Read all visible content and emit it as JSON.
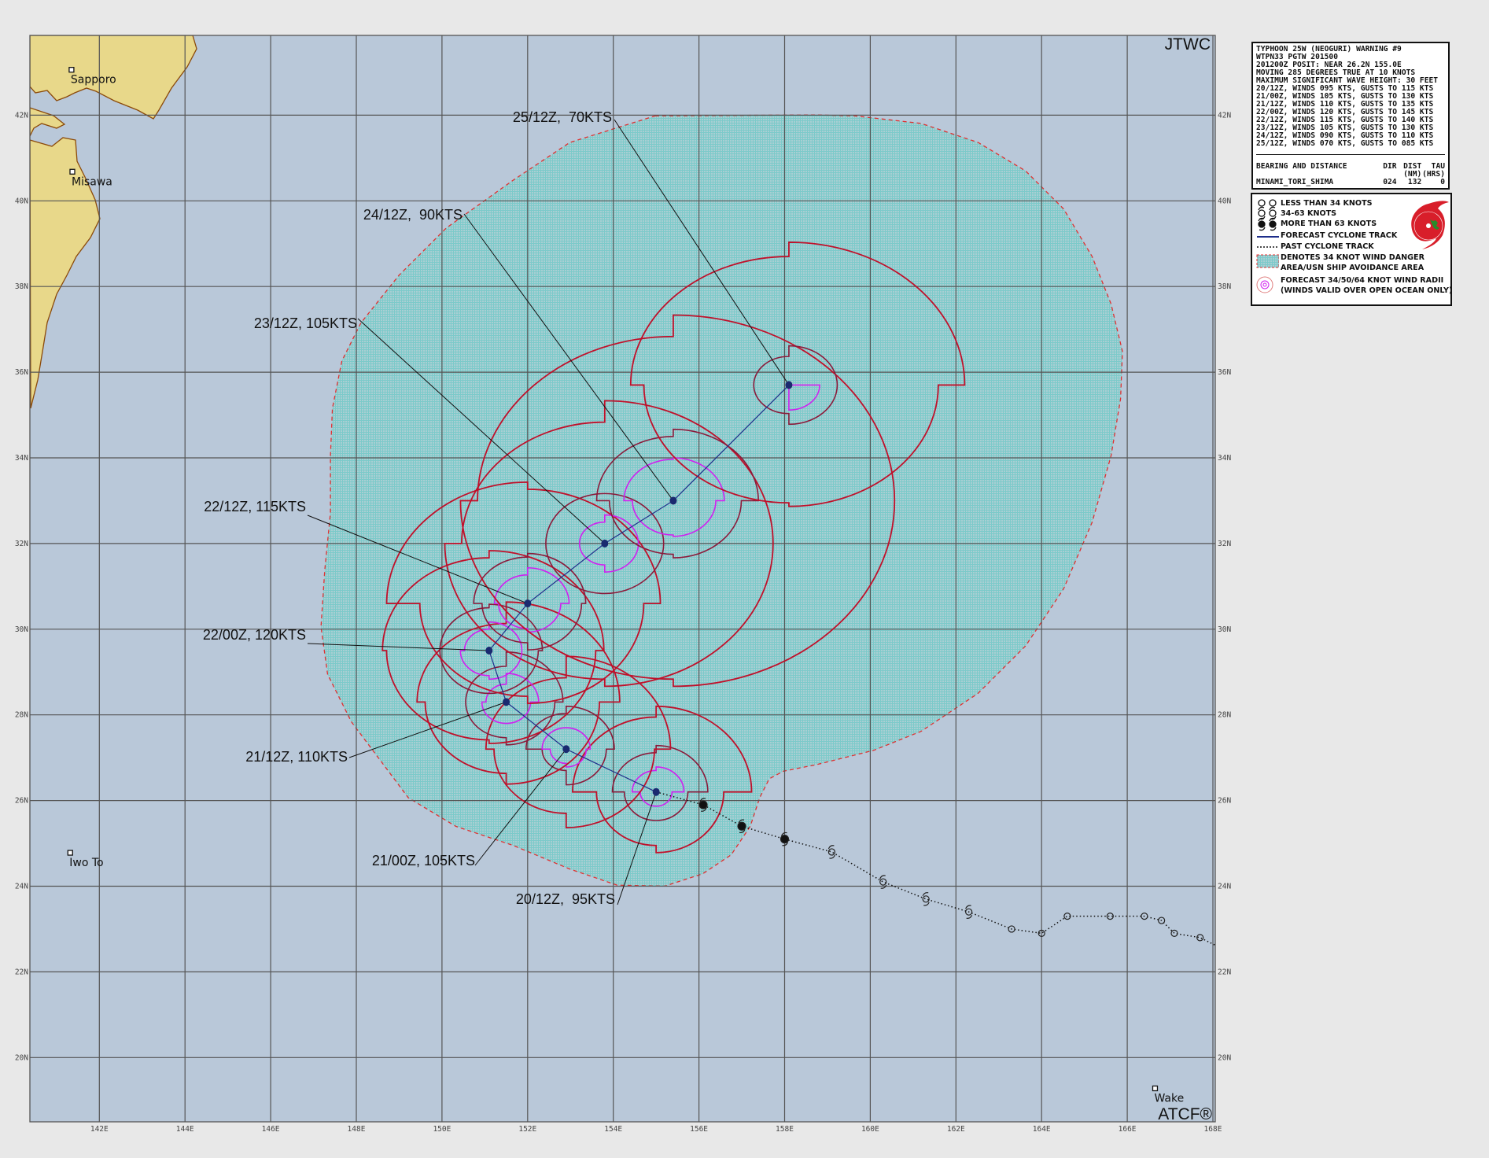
{
  "map": {
    "agency_label": "JTWC",
    "software_label": "ATCF®",
    "colors": {
      "ocean": "#b9c8d9",
      "land": "#e8d88a",
      "coast": "#8b4a0a",
      "grid": "#555555",
      "danger_area_fill": "#9fd0d0",
      "danger_area_outline": "#e03030",
      "radii_34kt": "#c0102a",
      "radii_50kt": "#8b1a3a",
      "radii_64kt": "#d020f0",
      "forecast_track": "#1e2e8a"
    },
    "longitude_ticks": [
      "142E",
      "144E",
      "146E",
      "148E",
      "150E",
      "152E",
      "154E",
      "156E",
      "158E",
      "160E",
      "162E",
      "164E",
      "166E",
      "168E"
    ],
    "latitude_ticks": [
      "20N",
      "22N",
      "24N",
      "26N",
      "28N",
      "30N",
      "32N",
      "34N",
      "36N",
      "38N",
      "40N",
      "42N"
    ],
    "places": [
      {
        "name": "Sapporo",
        "lat": 43.06,
        "lon": 141.35
      },
      {
        "name": "Misawa",
        "lat": 40.68,
        "lon": 141.37
      },
      {
        "name": "Iwo To",
        "lat": 24.78,
        "lon": 141.32
      },
      {
        "name": "Wake",
        "lat": 19.28,
        "lon": 166.65
      }
    ]
  },
  "forecast": [
    {
      "label": "20/12Z,  95KTS",
      "lat": 26.2,
      "lon": 155.0,
      "radii_nm": {
        "34": [
          120,
          85,
          75,
          105
        ],
        "50": [
          65,
          40,
          40,
          55
        ],
        "64": [
          35,
          20,
          20,
          30
        ]
      }
    },
    {
      "label": "21/00Z, 105KTS",
      "lat": 27.2,
      "lon": 152.9,
      "radii_nm": {
        "34": [
          130,
          110,
          90,
          100
        ],
        "50": [
          60,
          50,
          30,
          50
        ],
        "64": [
          30,
          25,
          20,
          30
        ]
      }
    },
    {
      "label": "21/12Z, 110KTS",
      "lat": 28.3,
      "lon": 151.5,
      "radii_nm": {
        "34": [
          140,
          115,
          100,
          110
        ],
        "50": [
          70,
          60,
          50,
          50
        ],
        "64": [
          40,
          30,
          30,
          25
        ]
      }
    },
    {
      "label": "22/00Z, 120KTS",
      "lat": 29.5,
      "lon": 151.1,
      "radii_nm": {
        "34": [
          140,
          130,
          125,
          130
        ],
        "50": [
          65,
          60,
          60,
          60
        ],
        "64": [
          40,
          40,
          35,
          30
        ]
      }
    },
    {
      "label": "22/12Z, 115KTS",
      "lat": 30.6,
      "lon": 152.0,
      "radii_nm": {
        "34": [
          160,
          140,
          130,
          170
        ],
        "50": [
          70,
          65,
          55,
          65
        ],
        "64": [
          50,
          40,
          35,
          40
        ]
      }
    },
    {
      "label": "23/12Z, 105KTS",
      "lat": 32.0,
      "lon": 153.8,
      "radii_nm": {
        "34": [
          200,
          200,
          190,
          170
        ],
        "50": [
          70,
          70,
          70,
          70
        ],
        "64": [
          40,
          40,
          30,
          30
        ]
      }
    },
    {
      "label": "24/12Z,  90KTS",
      "lat": 33.0,
      "lon": 155.4,
      "radii_nm": {
        "34": [
          260,
          260,
          250,
          230
        ],
        "50": [
          100,
          80,
          75,
          90
        ],
        "64": [
          60,
          50,
          48,
          58
        ]
      }
    },
    {
      "label": "25/12Z,  70KTS",
      "lat": 35.7,
      "lon": 158.1,
      "radii_nm": {
        "34": [
          200,
          170,
          165,
          180
        ],
        "50": [
          55,
          55,
          40,
          40
        ],
        "64": [
          0,
          35,
          0,
          0
        ]
      }
    }
  ],
  "past_track": [
    {
      "lat": 25.9,
      "lon": 156.1,
      "intensity": "more-than-63kt"
    },
    {
      "lat": 25.4,
      "lon": 157.0,
      "intensity": "more-than-63kt"
    },
    {
      "lat": 25.1,
      "lon": 158.0,
      "intensity": "more-than-63kt"
    },
    {
      "lat": 24.8,
      "lon": 159.1,
      "intensity": "34-63kt"
    },
    {
      "lat": 24.1,
      "lon": 160.3,
      "intensity": "34-63kt"
    },
    {
      "lat": 23.7,
      "lon": 161.3,
      "intensity": "34-63kt"
    },
    {
      "lat": 23.4,
      "lon": 162.3,
      "intensity": "34-63kt"
    },
    {
      "lat": 23.0,
      "lon": 163.3,
      "intensity": "less-than-34kt"
    },
    {
      "lat": 22.9,
      "lon": 164.0,
      "intensity": "less-than-34kt"
    },
    {
      "lat": 23.3,
      "lon": 164.6,
      "intensity": "less-than-34kt"
    },
    {
      "lat": 23.3,
      "lon": 165.6,
      "intensity": "less-than-34kt"
    },
    {
      "lat": 23.3,
      "lon": 166.4,
      "intensity": "less-than-34kt"
    },
    {
      "lat": 23.2,
      "lon": 166.8,
      "intensity": "less-than-34kt"
    },
    {
      "lat": 22.9,
      "lon": 167.1,
      "intensity": "less-than-34kt"
    },
    {
      "lat": 22.8,
      "lon": 167.7,
      "intensity": "less-than-34kt"
    }
  ],
  "warning_info": {
    "lines": [
      "TYPHOON 25W (NEOGURI) WARNING #9",
      "WTPN33 PGTW 201500",
      "201200Z POSIT: NEAR 26.2N 155.0E",
      "MOVING 285 DEGREES TRUE AT 10 KNOTS",
      "MAXIMUM SIGNIFICANT WAVE HEIGHT: 30 FEET",
      "20/12Z, WINDS 095 KTS, GUSTS TO 115 KTS",
      "21/00Z, WINDS 105 KTS, GUSTS TO 130 KTS",
      "21/12Z, WINDS 110 KTS, GUSTS TO 135 KTS",
      "22/00Z, WINDS 120 KTS, GUSTS TO 145 KTS",
      "22/12Z, WINDS 115 KTS, GUSTS TO 140 KTS",
      "23/12Z, WINDS 105 KTS, GUSTS TO 130 KTS",
      "24/12Z, WINDS 090 KTS, GUSTS TO 110 KTS",
      "25/12Z, WINDS 070 KTS, GUSTS TO 085 KTS"
    ],
    "bearing": {
      "title": "BEARING AND DISTANCE",
      "dir_header": "DIR",
      "dist_header": "DIST",
      "dist_unit": "(NM)",
      "tau_header": "TAU",
      "tau_unit": "(HRS)",
      "rows": [
        {
          "place": "MINAMI_TORI_SHIMA",
          "dir": "024",
          "dist": "132",
          "tau": "0"
        }
      ]
    }
  },
  "legend": {
    "items": [
      {
        "icon": "circle-open-icon",
        "label": "LESS THAN 34 KNOTS"
      },
      {
        "icon": "tropical-storm-icon",
        "label": "34-63 KNOTS"
      },
      {
        "icon": "typhoon-icon",
        "label": "MORE THAN 63 KNOTS"
      },
      {
        "icon": "forecast-track-line-icon",
        "label": "FORECAST CYCLONE TRACK"
      },
      {
        "icon": "past-track-dotted-icon",
        "label": "PAST CYCLONE TRACK"
      },
      {
        "icon": "danger-area-swatch-icon",
        "label": "DENOTES 34 KNOT WIND DANGER"
      },
      {
        "icon": "",
        "label": "AREA/USN SHIP AVOIDANCE AREA"
      },
      {
        "icon": "wind-radii-icon",
        "label": "FORECAST 34/50/64 KNOT WIND RADII"
      },
      {
        "icon": "",
        "label": "(WINDS VALID OVER OPEN OCEAN ONLY)"
      }
    ],
    "logo_icon": "jtwc-logo-icon"
  }
}
